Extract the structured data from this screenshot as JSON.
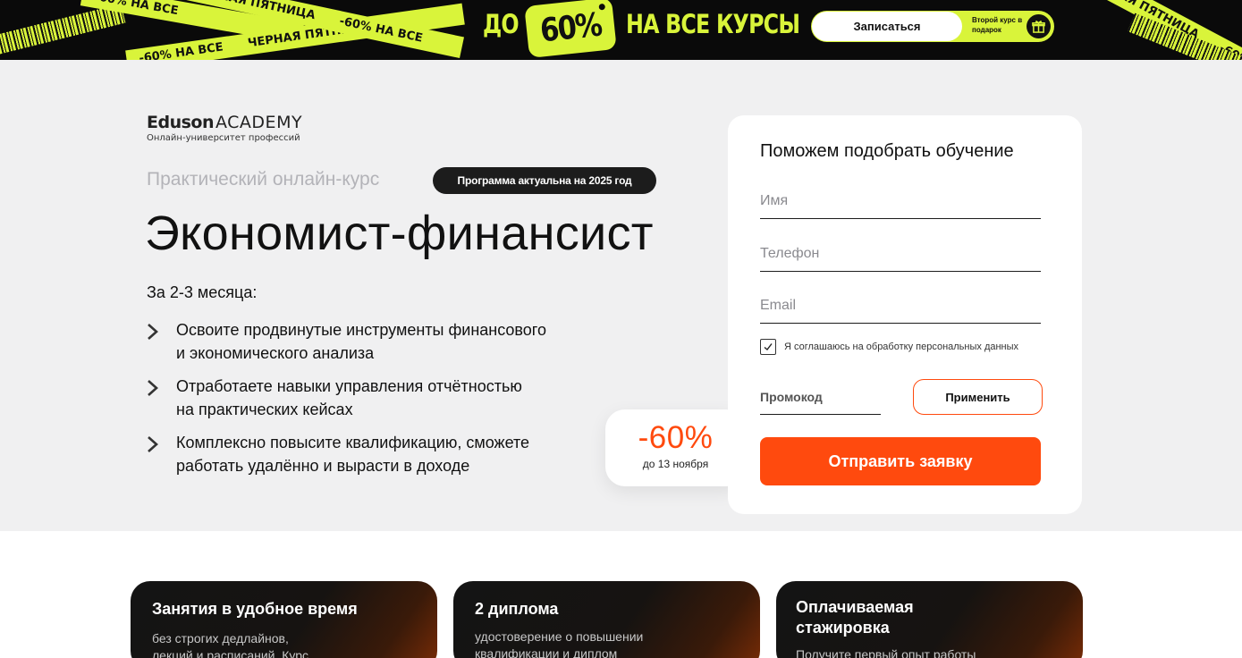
{
  "banner": {
    "tape_texts": [
      "-60% НА ВСЕ",
      "ЧЕРНАЯ ПЯТНИЦА",
      "-60% НА ВСЕ",
      "ЧЕРНАЯ ПЯТНИЦА"
    ],
    "headline_prefix": "ДО",
    "headline_badge": "60%",
    "headline_suffix": "НА ВСЕ КУРСЫ",
    "enroll_label": "Записаться",
    "second_course": "Второй курс в подарок",
    "gift_icon": "gift-icon",
    "accent_color": "#d9f43a"
  },
  "logo": {
    "brand": "Eduson",
    "academy": "ACADEMY",
    "tagline": "Онлайн-университет профессий"
  },
  "hero": {
    "course_type": "Практический онлайн-курс",
    "program_badge": "Программа актуальна на 2025 год",
    "title": "Экономист-финансист",
    "duration": "За 2-3 месяца:",
    "benefits": [
      {
        "line1": "Освоите продвинутые инструменты финансового",
        "line2": "и экономического анализа"
      },
      {
        "line1": "Отработаете навыки управления отчётностью",
        "line2": "на практических кейсах"
      },
      {
        "line1": "Комплексно повысите квалификацию, сможете",
        "line2": "работать удалённо и вырасти в доходе"
      }
    ],
    "chevron_icon": "chevron-right-icon",
    "discount": {
      "value": "-60%",
      "until": "до 13 ноября"
    }
  },
  "form": {
    "title": "Поможем подобрать обучение",
    "name_placeholder": "Имя",
    "phone_placeholder": "Телефон",
    "email_placeholder": "Email",
    "consent_checked": true,
    "consent_label": "Я соглашаюсь на обработку персональных данных",
    "promo_placeholder": "Промокод",
    "apply_label": "Применить",
    "submit_label": "Отправить заявку",
    "accent_color": "#ff4a0e"
  },
  "features": [
    {
      "title": "Занятия в удобное время",
      "text": "без строгих дедлайнов, лекций и расписаний. Курс"
    },
    {
      "title": "2 диплома",
      "text": "удостоверение о повышении квалификации и диплом"
    },
    {
      "title": "Оплачиваемая стажировка",
      "text": "Получите первый опыт работы"
    }
  ]
}
